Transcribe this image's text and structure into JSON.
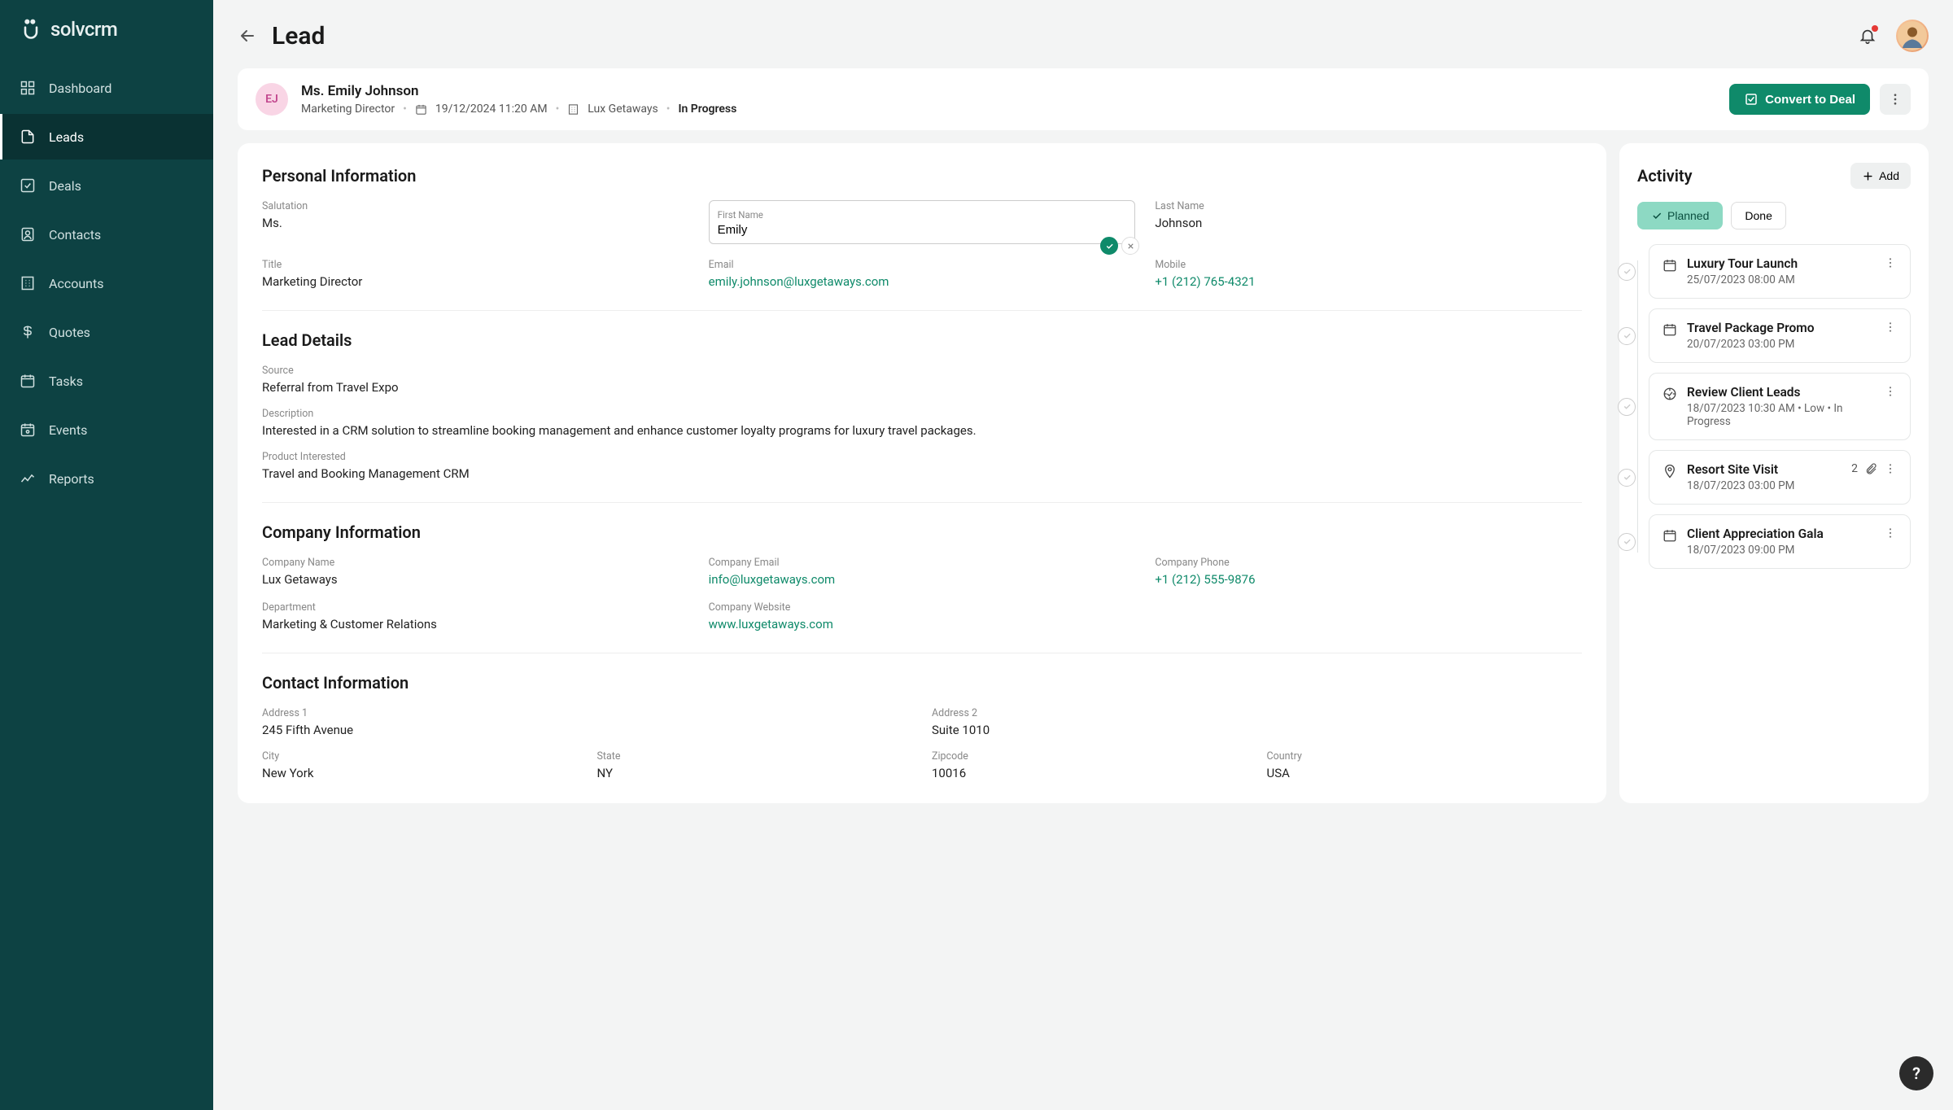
{
  "brand": "solvcrm",
  "nav": [
    {
      "icon": "grid",
      "label": "Dashboard"
    },
    {
      "icon": "file",
      "label": "Leads",
      "active": true
    },
    {
      "icon": "check-sq",
      "label": "Deals"
    },
    {
      "icon": "contact",
      "label": "Contacts"
    },
    {
      "icon": "building",
      "label": "Accounts"
    },
    {
      "icon": "dollar",
      "label": "Quotes"
    },
    {
      "icon": "calendar",
      "label": "Tasks"
    },
    {
      "icon": "event",
      "label": "Events"
    },
    {
      "icon": "chart",
      "label": "Reports"
    }
  ],
  "page_title": "Lead",
  "lead_header": {
    "initials": "EJ",
    "name": "Ms. Emily Johnson",
    "role": "Marketing Director",
    "date": "19/12/2024 11:20 AM",
    "company": "Lux Getaways",
    "status": "In Progress",
    "convert_label": "Convert to Deal"
  },
  "personal_info": {
    "title": "Personal Information",
    "salutation_label": "Salutation",
    "salutation": "Ms.",
    "first_name_label": "First Name",
    "first_name": "Emily",
    "last_name_label": "Last Name",
    "last_name": "Johnson",
    "title_label": "Title",
    "title_val": "Marketing Director",
    "email_label": "Email",
    "email": "emily.johnson@luxgetaways.com",
    "mobile_label": "Mobile",
    "mobile": "+1 (212) 765-4321"
  },
  "lead_details": {
    "title": "Lead Details",
    "source_label": "Source",
    "source": "Referral from Travel Expo",
    "description_label": "Description",
    "description": "Interested in a CRM solution to streamline booking management and enhance customer loyalty programs for luxury travel packages.",
    "product_label": "Product Interested",
    "product": "Travel and Booking Management CRM"
  },
  "company_info": {
    "title": "Company Information",
    "name_label": "Company Name",
    "name": "Lux Getaways",
    "email_label": "Company Email",
    "email": "info@luxgetaways.com",
    "phone_label": "Company Phone",
    "phone": "+1 (212) 555-9876",
    "dept_label": "Department",
    "dept": "Marketing & Customer Relations",
    "site_label": "Company Website",
    "site": "www.luxgetaways.com"
  },
  "contact_info": {
    "title": "Contact Information",
    "addr1_label": "Address 1",
    "addr1": "245 Fifth Avenue",
    "addr2_label": "Address 2",
    "addr2": "Suite 1010",
    "city_label": "City",
    "city": "New York",
    "state_label": "State",
    "state": "NY",
    "zip_label": "Zipcode",
    "zip": "10016",
    "country_label": "Country",
    "country": "USA"
  },
  "activity": {
    "title": "Activity",
    "add_label": "Add",
    "tab_planned": "Planned",
    "tab_done": "Done",
    "items": [
      {
        "icon": "cal",
        "title": "Luxury Tour Launch",
        "meta": "25/07/2023 08:00 AM"
      },
      {
        "icon": "cal",
        "title": "Travel Package Promo",
        "meta": "20/07/2023 03:00 PM"
      },
      {
        "icon": "target",
        "title": "Review Client Leads",
        "meta": "18/07/2023 10:30 AM  •  Low  •  In Progress"
      },
      {
        "icon": "pin",
        "title": "Resort Site Visit",
        "meta": "18/07/2023 03:00 PM",
        "attach": "2"
      },
      {
        "icon": "cal",
        "title": "Client Appreciation Gala",
        "meta": "18/07/2023 09:00 PM"
      }
    ]
  }
}
